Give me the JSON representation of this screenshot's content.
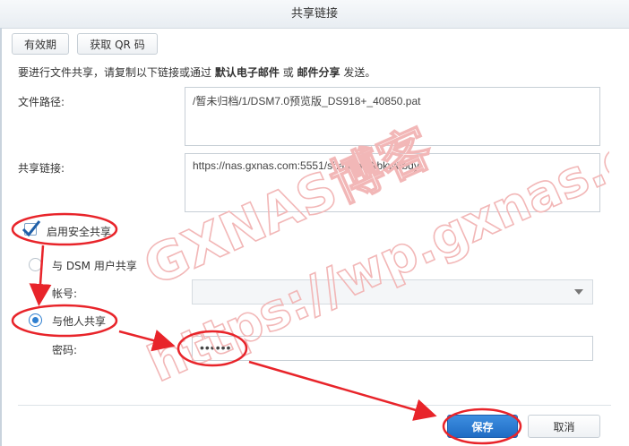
{
  "dialog": {
    "title": "共享链接"
  },
  "toolbar": {
    "validity_label": "有效期",
    "qr_label": "获取 QR 码"
  },
  "instruction": {
    "prefix": "要进行文件共享，请复制以下链接或通过",
    "email_default": "默认电子邮件",
    "or_text": "或",
    "email_share": "邮件分享",
    "suffix": "发送。"
  },
  "file_path": {
    "label": "文件路径:",
    "value": "/暂未归档/1/DSM7.0预览版_DS918+_40850.pat"
  },
  "share_link": {
    "label": "共享链接:",
    "value": "https://nas.gxnas.com:5551/sharing/bkbkw6bqy"
  },
  "secure_share": {
    "label": "启用安全共享",
    "checked": true
  },
  "dsm_share": {
    "label": "与 DSM 用户共享",
    "selected": false
  },
  "account": {
    "label": "帐号:",
    "value": ""
  },
  "other_share": {
    "label": "与他人共享",
    "selected": true
  },
  "password": {
    "label": "密码:",
    "value": "••••••"
  },
  "footer": {
    "save_label": "保存",
    "cancel_label": "取消"
  },
  "watermark": {
    "line1": "GXNAS博客",
    "line2": "https://wp.gxnas.com"
  },
  "colors": {
    "annotation_red": "#e8242a",
    "accent_blue": "#2f7fd0"
  }
}
